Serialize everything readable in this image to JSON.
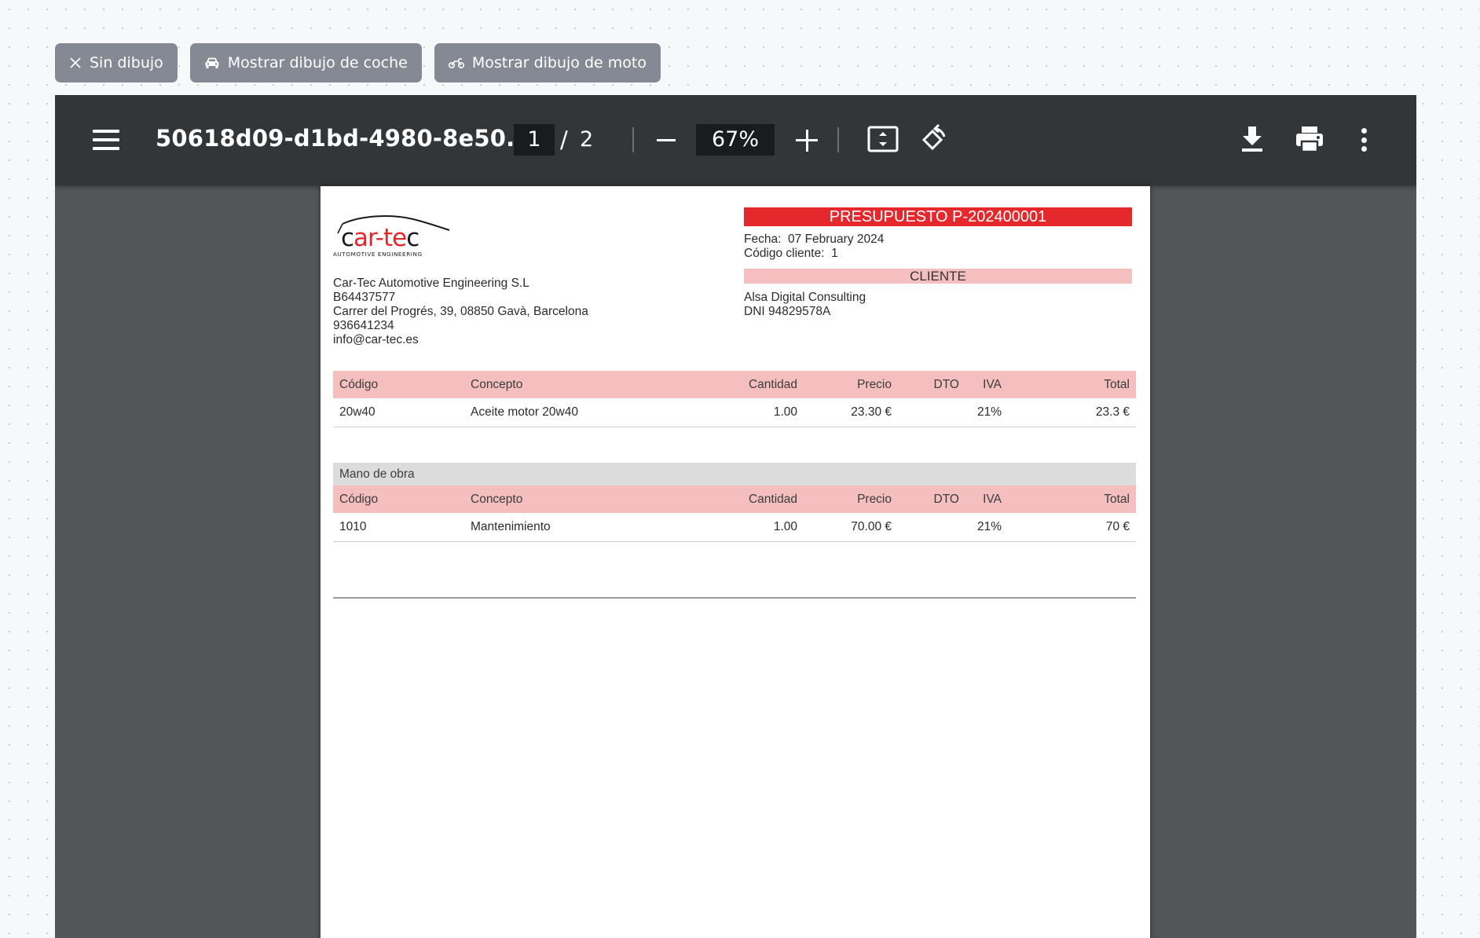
{
  "mode_buttons": [
    {
      "label": "Sin dibujo",
      "icon": "close-icon"
    },
    {
      "label": "Mostrar dibujo de coche",
      "icon": "car-icon"
    },
    {
      "label": "Mostrar dibujo de moto",
      "icon": "motorcycle-icon"
    }
  ],
  "viewer": {
    "title": "50618d09-d1bd-4980-8e50...",
    "current_page": "1",
    "page_separator": "/",
    "total_pages": "2",
    "zoom": "67%"
  },
  "document": {
    "logo_text": "car-tec",
    "logo_subtext": "AUTOMOTIVE ENGINEERING",
    "company": {
      "name": "Car-Tec Automotive Engineering S.L",
      "cif": "B64437577",
      "address": "Carrer del Progrés, 39, 08850 Gavà, Barcelona",
      "phone": "936641234",
      "email": "info@car-tec.es"
    },
    "presupuesto_title": "PRESUPUESTO P-202400001",
    "fecha_label": "Fecha:",
    "fecha_value": "07 February 2024",
    "codigo_cliente_label": "Código cliente:",
    "codigo_cliente_value": "1",
    "cliente_header": "CLIENTE",
    "client": {
      "name": "Alsa Digital Consulting",
      "dni": "DNI 94829578A"
    },
    "columns": {
      "codigo": "Código",
      "concepto": "Concepto",
      "cantidad": "Cantidad",
      "precio": "Precio",
      "dto": "DTO",
      "iva": "IVA",
      "total": "Total"
    },
    "parts_table": {
      "rows": [
        {
          "codigo": "20w40",
          "concepto": "Aceite motor 20w40",
          "cantidad": "1.00",
          "precio": "23.30 €",
          "dto": "",
          "iva": "21%",
          "total": "23.3 €"
        }
      ]
    },
    "labor_table": {
      "section_title": "Mano de obra",
      "rows": [
        {
          "codigo": "1010",
          "concepto": "Mantenimiento",
          "cantidad": "1.00",
          "precio": "70.00 €",
          "dto": "",
          "iva": "21%",
          "total": "70 €"
        }
      ]
    }
  },
  "colors": {
    "accent_red": "#e5282c",
    "header_pink": "#f5bfbf",
    "toolbar": "#323639",
    "viewer_bg": "#525659"
  }
}
